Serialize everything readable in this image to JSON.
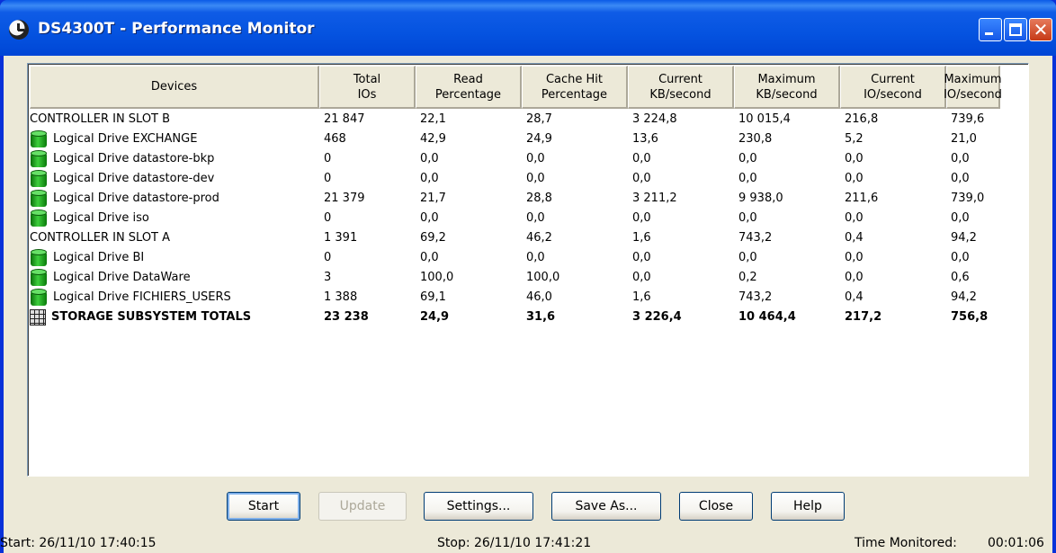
{
  "window": {
    "title": "DS4300T - Performance Monitor",
    "accent": "#0831d9"
  },
  "table": {
    "headers": [
      {
        "line1": "Devices",
        "line2": ""
      },
      {
        "line1": "Total",
        "line2": "IOs"
      },
      {
        "line1": "Read",
        "line2": "Percentage"
      },
      {
        "line1": "Cache Hit",
        "line2": "Percentage"
      },
      {
        "line1": "Current",
        "line2": "KB/second"
      },
      {
        "line1": "Maximum",
        "line2": "KB/second"
      },
      {
        "line1": "Current",
        "line2": "IO/second"
      },
      {
        "line1": "Maximum",
        "line2": "IO/second"
      }
    ],
    "rows": [
      {
        "icon": "",
        "device": "CONTROLLER IN SLOT B",
        "total": "21 847",
        "read": "22,1",
        "cache": "28,7",
        "curkb": "3 224,8",
        "maxkb": "10 015,4",
        "curio": "216,8",
        "maxio": "739,6"
      },
      {
        "icon": "logical-drive-icon",
        "device": "Logical Drive EXCHANGE",
        "total": "468",
        "read": "42,9",
        "cache": "24,9",
        "curkb": "13,6",
        "maxkb": "230,8",
        "curio": "5,2",
        "maxio": "21,0"
      },
      {
        "icon": "logical-drive-icon",
        "device": "Logical Drive datastore-bkp",
        "total": "0",
        "read": "0,0",
        "cache": "0,0",
        "curkb": "0,0",
        "maxkb": "0,0",
        "curio": "0,0",
        "maxio": "0,0"
      },
      {
        "icon": "logical-drive-icon",
        "device": "Logical Drive datastore-dev",
        "total": "0",
        "read": "0,0",
        "cache": "0,0",
        "curkb": "0,0",
        "maxkb": "0,0",
        "curio": "0,0",
        "maxio": "0,0"
      },
      {
        "icon": "logical-drive-icon",
        "device": "Logical Drive datastore-prod",
        "total": "21 379",
        "read": "21,7",
        "cache": "28,8",
        "curkb": "3 211,2",
        "maxkb": "9 938,0",
        "curio": "211,6",
        "maxio": "739,0"
      },
      {
        "icon": "logical-drive-icon",
        "device": "Logical Drive iso",
        "total": "0",
        "read": "0,0",
        "cache": "0,0",
        "curkb": "0,0",
        "maxkb": "0,0",
        "curio": "0,0",
        "maxio": "0,0"
      },
      {
        "icon": "",
        "device": "CONTROLLER IN SLOT A",
        "total": "1 391",
        "read": "69,2",
        "cache": "46,2",
        "curkb": "1,6",
        "maxkb": "743,2",
        "curio": "0,4",
        "maxio": "94,2"
      },
      {
        "icon": "logical-drive-icon",
        "device": "Logical Drive BI",
        "total": "0",
        "read": "0,0",
        "cache": "0,0",
        "curkb": "0,0",
        "maxkb": "0,0",
        "curio": "0,0",
        "maxio": "0,0"
      },
      {
        "icon": "logical-drive-icon",
        "device": "Logical Drive DataWare",
        "total": "3",
        "read": "100,0",
        "cache": "100,0",
        "curkb": "0,0",
        "maxkb": "0,2",
        "curio": "0,0",
        "maxio": "0,6"
      },
      {
        "icon": "logical-drive-icon",
        "device": "Logical Drive FICHIERS_USERS",
        "total": "1 388",
        "read": "69,1",
        "cache": "46,0",
        "curkb": "1,6",
        "maxkb": "743,2",
        "curio": "0,4",
        "maxio": "94,2"
      },
      {
        "icon": "totals-icon",
        "device": "STORAGE SUBSYSTEM TOTALS",
        "total": "23 238",
        "read": "24,9",
        "cache": "31,6",
        "curkb": "3 226,4",
        "maxkb": "10 464,4",
        "curio": "217,2",
        "maxio": "756,8",
        "bold": true
      }
    ]
  },
  "buttons": {
    "start": "Start",
    "update": "Update",
    "settings": "Settings...",
    "save_as": "Save As...",
    "close": "Close",
    "help": "Help"
  },
  "status": {
    "start": "Start:  26/11/10 17:40:15",
    "stop": "Stop:  26/11/10 17:41:21",
    "time_label": "Time Monitored:",
    "time_value": "00:01:06"
  }
}
